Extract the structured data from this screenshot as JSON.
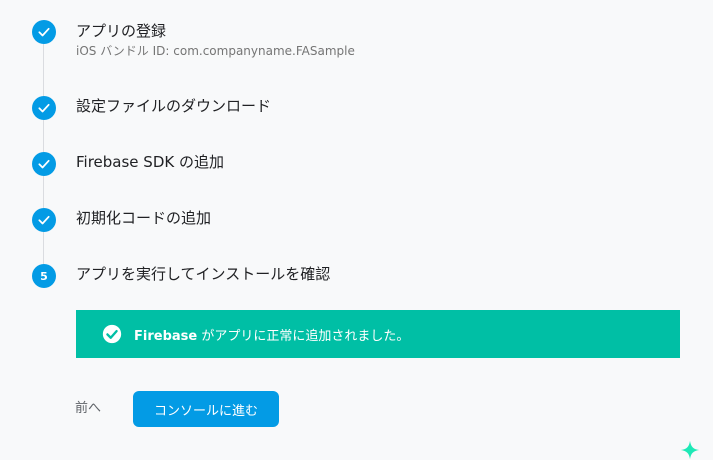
{
  "steps": [
    {
      "state": "done",
      "title": "アプリの登録",
      "subtitle": "iOS バンドル ID: com.companyname.FASample"
    },
    {
      "state": "done",
      "title": "設定ファイルのダウンロード"
    },
    {
      "state": "done",
      "title": "Firebase SDK の追加"
    },
    {
      "state": "done",
      "title": "初期化コードの追加"
    },
    {
      "state": "current",
      "number": "5",
      "title": "アプリを実行してインストールを確認"
    }
  ],
  "success_banner": {
    "strong": "Firebase",
    "message": " がアプリに正常に追加されました。"
  },
  "actions": {
    "back_label": "前へ",
    "continue_label": "コンソールに進む"
  },
  "colors": {
    "step_blue": "#039be5",
    "success_green": "#00bfa5",
    "sparkle_teal": "#1de9b6"
  },
  "icons": {
    "done_step": "check-icon",
    "success": "check-circle-icon",
    "corner": "sparkle-icon"
  }
}
